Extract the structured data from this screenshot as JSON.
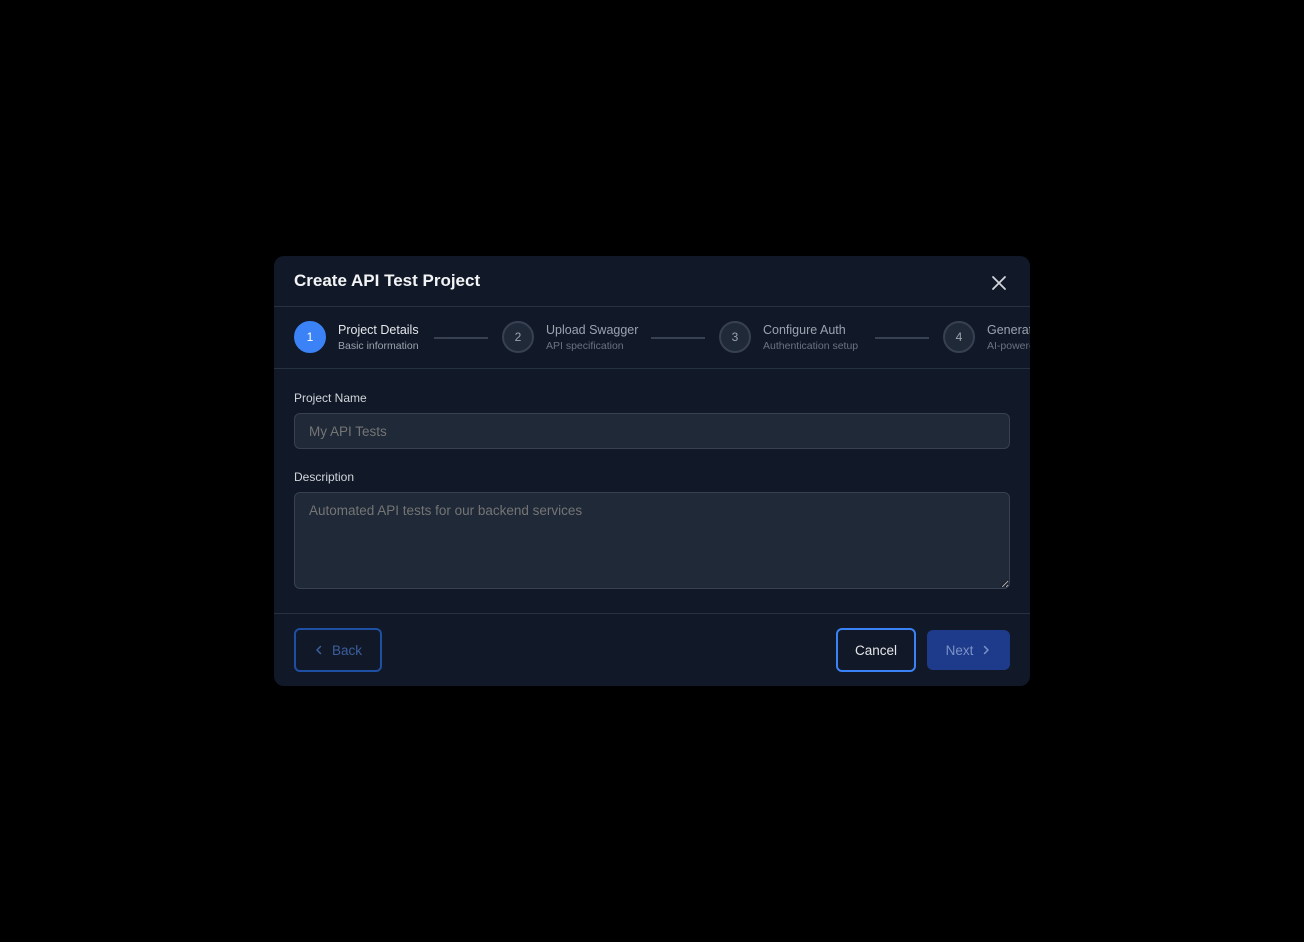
{
  "modal": {
    "title": "Create API Test Project"
  },
  "steps": [
    {
      "number": "1",
      "title": "Project Details",
      "subtitle": "Basic information",
      "active": true
    },
    {
      "number": "2",
      "title": "Upload Swagger",
      "subtitle": "API specification",
      "active": false
    },
    {
      "number": "3",
      "title": "Configure Auth",
      "subtitle": "Authentication setup",
      "active": false
    },
    {
      "number": "4",
      "title": "Generate",
      "subtitle": "AI-powered",
      "active": false
    }
  ],
  "form": {
    "project_name_label": "Project Name",
    "project_name_placeholder": "My API Tests",
    "description_label": "Description",
    "description_placeholder": "Automated API tests for our backend services"
  },
  "footer": {
    "back_label": "Back",
    "cancel_label": "Cancel",
    "next_label": "Next"
  },
  "colors": {
    "background": "#000000",
    "modal": "#111827",
    "accent": "#3b82f6",
    "input_bg": "#1f2937",
    "next_button": "#1e3a8a"
  },
  "icons": {
    "close": "close-icon",
    "back": "chevron-left-icon",
    "next": "chevron-right-icon"
  }
}
